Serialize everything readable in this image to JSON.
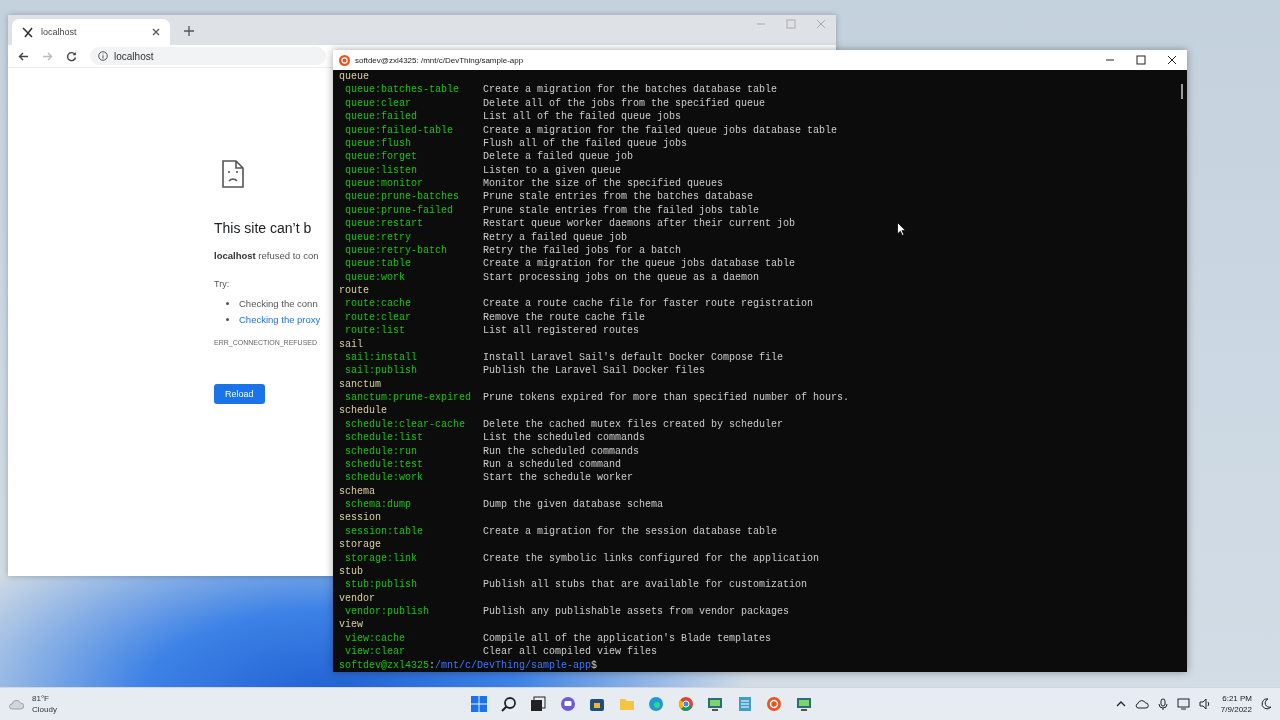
{
  "browser": {
    "tab_title": "localhost",
    "address": "localhost",
    "heading": "This site can’t b",
    "message": "**localhost** refused to con",
    "try_label": "Try:",
    "suggestions": [
      {
        "text": "Checking the conn",
        "kind": "plain"
      },
      {
        "text": "Checking the proxy",
        "kind": "link"
      }
    ],
    "error_code": "ERR_CONNECTION_REFUSED",
    "reload_button": "Reload"
  },
  "terminal": {
    "title": "softdev@zxl4325: /mnt/c/DevThing/sample-app",
    "groups": [
      {
        "name": "queue",
        "commands": [
          {
            "name": "queue:batches-table",
            "description": "Create a migration for the batches database table"
          },
          {
            "name": "queue:clear",
            "description": "Delete all of the jobs from the specified queue"
          },
          {
            "name": "queue:failed",
            "description": "List all of the failed queue jobs"
          },
          {
            "name": "queue:failed-table",
            "description": "Create a migration for the failed queue jobs database table"
          },
          {
            "name": "queue:flush",
            "description": "Flush all of the failed queue jobs"
          },
          {
            "name": "queue:forget",
            "description": "Delete a failed queue job"
          },
          {
            "name": "queue:listen",
            "description": "Listen to a given queue"
          },
          {
            "name": "queue:monitor",
            "description": "Monitor the size of the specified queues"
          },
          {
            "name": "queue:prune-batches",
            "description": "Prune stale entries from the batches database"
          },
          {
            "name": "queue:prune-failed",
            "description": "Prune stale entries from the failed jobs table"
          },
          {
            "name": "queue:restart",
            "description": "Restart queue worker daemons after their current job"
          },
          {
            "name": "queue:retry",
            "description": "Retry a failed queue job"
          },
          {
            "name": "queue:retry-batch",
            "description": "Retry the failed jobs for a batch"
          },
          {
            "name": "queue:table",
            "description": "Create a migration for the queue jobs database table"
          },
          {
            "name": "queue:work",
            "description": "Start processing jobs on the queue as a daemon"
          }
        ]
      },
      {
        "name": "route",
        "commands": [
          {
            "name": "route:cache",
            "description": "Create a route cache file for faster route registration"
          },
          {
            "name": "route:clear",
            "description": "Remove the route cache file"
          },
          {
            "name": "route:list",
            "description": "List all registered routes"
          }
        ]
      },
      {
        "name": "sail",
        "commands": [
          {
            "name": "sail:install",
            "description": "Install Laravel Sail's default Docker Compose file"
          },
          {
            "name": "sail:publish",
            "description": "Publish the Laravel Sail Docker files"
          }
        ]
      },
      {
        "name": "sanctum",
        "commands": [
          {
            "name": "sanctum:prune-expired",
            "description": "Prune tokens expired for more than specified number of hours."
          }
        ]
      },
      {
        "name": "schedule",
        "commands": [
          {
            "name": "schedule:clear-cache",
            "description": "Delete the cached mutex files created by scheduler"
          },
          {
            "name": "schedule:list",
            "description": "List the scheduled commands"
          },
          {
            "name": "schedule:run",
            "description": "Run the scheduled commands"
          },
          {
            "name": "schedule:test",
            "description": "Run a scheduled command"
          },
          {
            "name": "schedule:work",
            "description": "Start the schedule worker"
          }
        ]
      },
      {
        "name": "schema",
        "commands": [
          {
            "name": "schema:dump",
            "description": "Dump the given database schema"
          }
        ]
      },
      {
        "name": "session",
        "commands": [
          {
            "name": "session:table",
            "description": "Create a migration for the session database table"
          }
        ]
      },
      {
        "name": "storage",
        "commands": [
          {
            "name": "storage:link",
            "description": "Create the symbolic links configured for the application"
          }
        ]
      },
      {
        "name": "stub",
        "commands": [
          {
            "name": "stub:publish",
            "description": "Publish all stubs that are available for customization"
          }
        ]
      },
      {
        "name": "vendor",
        "commands": [
          {
            "name": "vendor:publish",
            "description": "Publish any publishable assets from vendor packages"
          }
        ]
      },
      {
        "name": "view",
        "commands": [
          {
            "name": "view:cache",
            "description": "Compile all of the application's Blade templates"
          },
          {
            "name": "view:clear",
            "description": "Clear all compiled view files"
          }
        ]
      }
    ],
    "prompt": {
      "user": "softdev@zxl4325",
      "separator": ":",
      "path": "/mnt/c/DevThing/sample-app",
      "symbol": "$"
    }
  },
  "taskbar": {
    "temperature": "81°F",
    "condition": "Cloudy",
    "time": "6:21 PM",
    "date": "7/9/2022"
  }
}
